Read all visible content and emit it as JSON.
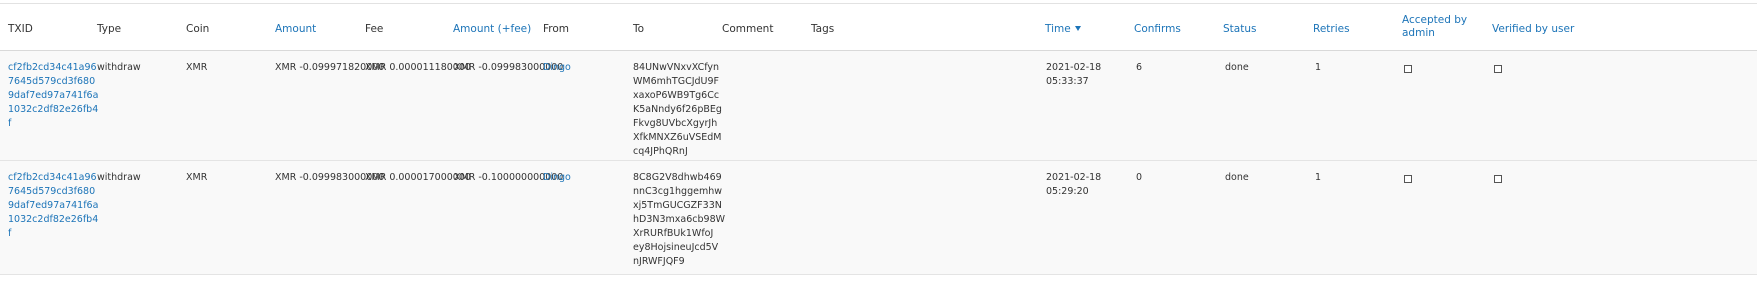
{
  "headers": {
    "txid": "TXID",
    "type": "Type",
    "coin": "Coin",
    "amount": "Amount",
    "fee": "Fee",
    "amount_fee": "Amount (+fee)",
    "from": "From",
    "to": "To",
    "comment": "Comment",
    "tags": "Tags",
    "time": "Time",
    "confirms": "Confirms",
    "status": "Status",
    "retries": "Retries",
    "accepted": "Accepted by\nadmin",
    "verified": "Verified by user"
  },
  "rows": [
    {
      "txid": "cf2fb2cd34c41a96\n7645d579cd3f680\n9daf7ed97a741f6a\n1032c2df82e26fb4\nf",
      "type": "withdraw",
      "coin": "XMR",
      "amount": "XMR -0.099971820000",
      "fee": "XMR 0.000011180000",
      "amount_fee": "XMR -0.099983000000",
      "from": "Dingo",
      "to": "84UNwVNxvXCfyn\nWM6mhTGCJdU9F\nxaxoP6WB9Tg6Cc\nK5aNndy6f26pBEg\nFkvg8UVbcXgyrJh\nXfkMNXZ6uVSEdM\ncq4JPhQRnJ",
      "comment": "",
      "tags": "",
      "time": "2021-02-18\n05:33:37",
      "confirms": "6",
      "status": "done",
      "retries": "1",
      "accepted": false,
      "verified": false
    },
    {
      "txid": "cf2fb2cd34c41a96\n7645d579cd3f680\n9daf7ed97a741f6a\n1032c2df82e26fb4\nf",
      "type": "withdraw",
      "coin": "XMR",
      "amount": "XMR -0.099983000000",
      "fee": "XMR 0.000017000000",
      "amount_fee": "XMR -0.100000000000",
      "from": "Dingo",
      "to": "8C8G2V8dhwb469\nnnC3cg1hggemhw\nxj5TmGUCGZF33N\nhD3N3mxa6cb98W\nXrRURfBUk1WfoJ\ney8HojsineuJcd5V\nnJRWFJQF9",
      "comment": "",
      "tags": "",
      "time": "2021-02-18\n05:29:20",
      "confirms": "0",
      "status": "done",
      "retries": "1",
      "accepted": false,
      "verified": false
    }
  ]
}
